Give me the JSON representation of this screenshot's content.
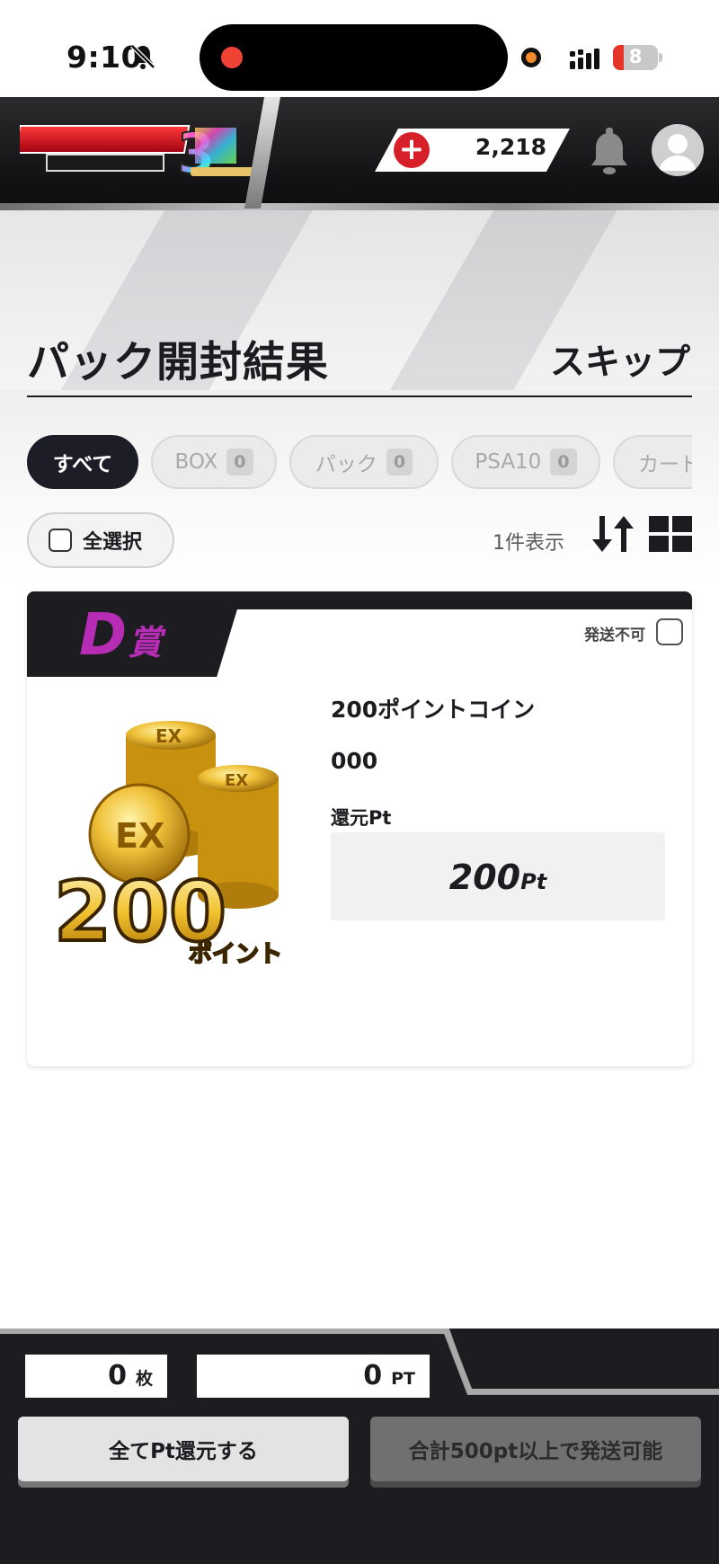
{
  "status_bar": {
    "time": "9:10",
    "battery_level": "8",
    "icons": [
      "bell-slash-icon",
      "record-indicator-icon",
      "mic-indicator-icon",
      "signal-icon",
      "battery-icon"
    ]
  },
  "header": {
    "logo_alt": "エクストレカ EXTORECA 3周年 Anniversary",
    "points": "2,218",
    "icons": [
      "plus-icon",
      "bell-icon",
      "avatar-icon"
    ]
  },
  "page": {
    "title": "パック開封結果",
    "skip_label": "スキップ"
  },
  "tabs": [
    {
      "label": "すべて",
      "count": null,
      "active": true
    },
    {
      "label": "BOX",
      "count": "0",
      "active": false
    },
    {
      "label": "パック",
      "count": "0",
      "active": false
    },
    {
      "label": "PSA10",
      "count": "0",
      "active": false
    },
    {
      "label": "カード",
      "count": "0",
      "active": false
    }
  ],
  "toolbar": {
    "select_all_label": "全選択",
    "count_label": "1件表示"
  },
  "card": {
    "rank": "D",
    "rank_suffix": "賞",
    "no_ship_label": "発送不可",
    "item_name": "200ポイントコイン",
    "item_code": "000",
    "return_label": "還元Pt",
    "return_value": "200",
    "return_unit": "Pt",
    "image": {
      "amount": "200",
      "caption": "ポイント",
      "coin_mark": "EX"
    }
  },
  "footer": {
    "quantity": "0",
    "quantity_unit": "枚",
    "points_total": "0",
    "points_unit": "PT",
    "return_all_button": "全てPt還元する",
    "ship_button": "合計500pt以上で発送可能"
  },
  "colors": {
    "accent_red": "#d71f2a",
    "dark": "#1d1d21",
    "rank_purple": "#b72cb5"
  }
}
